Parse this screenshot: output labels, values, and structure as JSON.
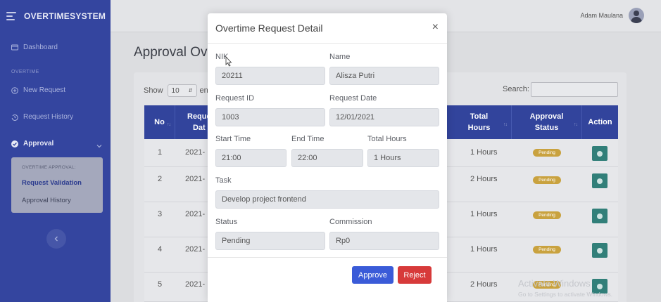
{
  "app": {
    "brand": "OVERTIMESYSTEM"
  },
  "sidebar": {
    "dashboard": "Dashboard",
    "section_overtime": "OVERTIME",
    "new_request": "New Request",
    "request_history": "Request History",
    "approval": "Approval",
    "sub_section": "OVERTIME APPROVAL:",
    "request_validation": "Request Validation",
    "approval_history": "Approval History"
  },
  "topbar": {
    "user_name": "Adam Maulana"
  },
  "page": {
    "title": "Approval Ov"
  },
  "table_controls": {
    "show_label": "Show",
    "show_value": "10",
    "entries_fragment": "en",
    "search_label": "Search:"
  },
  "table": {
    "headers": {
      "no": "No",
      "request_date": [
        "Reque",
        "Dat"
      ],
      "total_hours": [
        "Total",
        "Hours"
      ],
      "approval_status": [
        "Approval",
        "Status"
      ],
      "action": "Action"
    },
    "rows": [
      {
        "no": "1",
        "date": "2021-",
        "hours": "1 Hours",
        "status": "Pending"
      },
      {
        "no": "2",
        "date": "2021-",
        "hours": "2 Hours",
        "status": "Pending"
      },
      {
        "no": "3",
        "date": "2021-",
        "hours": "1 Hours",
        "status": "Pending"
      },
      {
        "no": "4",
        "date": "2021-",
        "hours": "1 Hours",
        "status": "Pending"
      },
      {
        "no": "5",
        "date": "2021-",
        "hours": "2 Hours",
        "status": "Pending"
      }
    ]
  },
  "modal": {
    "title": "Overtime Request Detail",
    "close": "×",
    "fields": {
      "nik_label": "NIK",
      "nik": "20211",
      "name_label": "Name",
      "name": "Alisza Putri",
      "request_id_label": "Request ID",
      "request_id": "1003",
      "request_date_label": "Request Date",
      "request_date": "12/01/2021",
      "start_time_label": "Start Time",
      "start_time": "21:00",
      "end_time_label": "End Time",
      "end_time": "22:00",
      "total_hours_label": "Total Hours",
      "total_hours": "1 Hours",
      "task_label": "Task",
      "task": "Develop project frontend",
      "status_label": "Status",
      "status": "Pending",
      "commission_label": "Commission",
      "commission": "Rp0"
    },
    "approve": "Approve",
    "reject": "Reject"
  },
  "watermark": {
    "line1": "Activate Windows",
    "line2": "Go to Settings to activate Windows."
  },
  "colors": {
    "sidebar": "#34459f",
    "approve": "#3a5bd8",
    "reject": "#d73a3a",
    "badge": "#c9a23f",
    "action": "#317f79"
  }
}
